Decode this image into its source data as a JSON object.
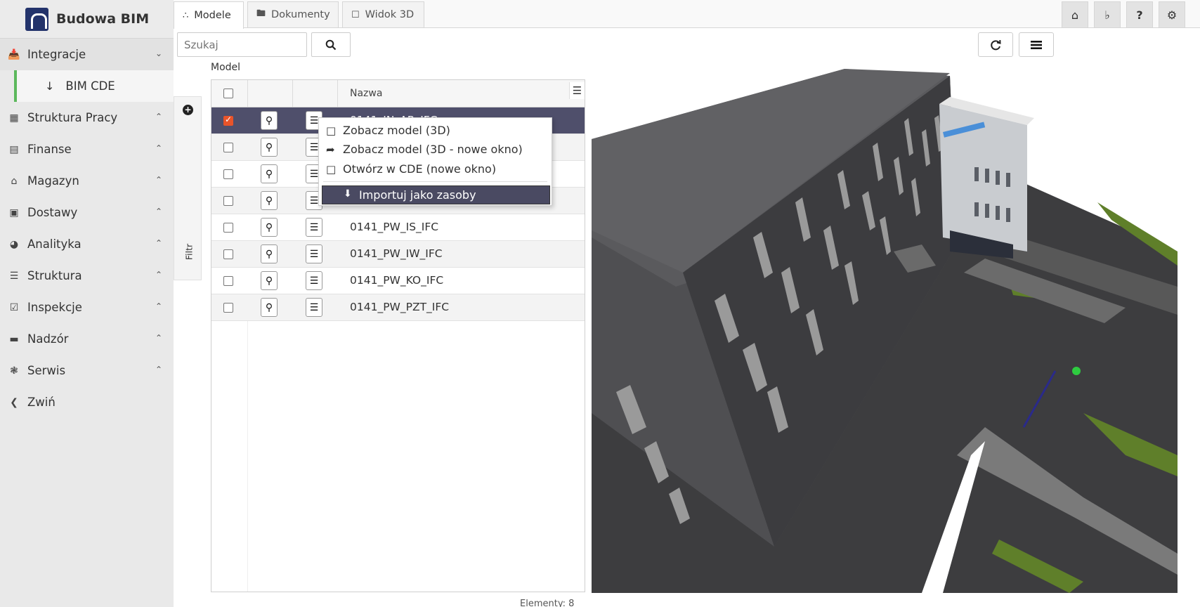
{
  "app": {
    "title": "Budowa BIM"
  },
  "sidebar": {
    "items": [
      {
        "label": "Integracje",
        "icon": "inbox-icon"
      },
      {
        "label": "BIM CDE",
        "icon": "arrow-down-icon"
      },
      {
        "label": "Struktura Pracy",
        "icon": "building-icon"
      },
      {
        "label": "Finanse",
        "icon": "money-icon"
      },
      {
        "label": "Magazyn",
        "icon": "warehouse-icon"
      },
      {
        "label": "Dostawy",
        "icon": "truck-icon"
      },
      {
        "label": "Analityka",
        "icon": "gauge-icon"
      },
      {
        "label": "Struktura",
        "icon": "layers-icon"
      },
      {
        "label": "Inspekcje",
        "icon": "checkbox-icon"
      },
      {
        "label": "Nadzór",
        "icon": "card-icon"
      },
      {
        "label": "Serwis",
        "icon": "bug-icon"
      },
      {
        "label": "Zwiń",
        "icon": "chevron-left-icon"
      }
    ]
  },
  "tabs": [
    {
      "label": "Modele",
      "icon": "cubes-icon"
    },
    {
      "label": "Dokumenty",
      "icon": "folder-icon"
    },
    {
      "label": "Widok 3D",
      "icon": "square-icon"
    }
  ],
  "search": {
    "placeholder": "Szukaj"
  },
  "filter": {
    "label": "Filtr"
  },
  "grid": {
    "title": "Model",
    "column_name": "Nazwa",
    "rows": [
      {
        "name": "0141_IN_AR_IFC",
        "checked": true
      },
      {
        "name": "",
        "checked": false
      },
      {
        "name": "",
        "checked": false
      },
      {
        "name": "",
        "checked": false
      },
      {
        "name": "0141_PW_IS_IFC",
        "checked": false
      },
      {
        "name": "0141_PW_IW_IFC",
        "checked": false
      },
      {
        "name": "0141_PW_KO_IFC",
        "checked": false
      },
      {
        "name": "0141_PW_PZT_IFC",
        "checked": false
      }
    ],
    "footer": "Elementy: 8"
  },
  "context_menu": {
    "items": [
      {
        "label": "Zobacz model (3D)",
        "icon": "frame-icon"
      },
      {
        "label": "Zobacz model (3D - nowe okno)",
        "icon": "share-arrow-icon"
      },
      {
        "label": "Otwórz w CDE (nowe okno)",
        "icon": "frame-icon"
      },
      {
        "label": "Importuj jako zasoby",
        "icon": "download-icon"
      }
    ]
  },
  "colors": {
    "accent": "#e8542a",
    "selected_row": "#4f4f6b",
    "brand": "#23336b",
    "sidebar_active_border": "#5cb85c"
  }
}
